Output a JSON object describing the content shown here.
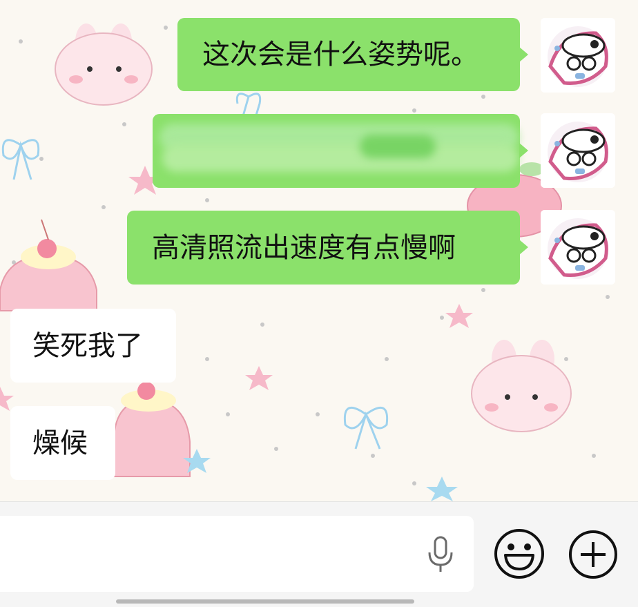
{
  "chat": {
    "messages": [
      {
        "side": "out",
        "text": "这次会是什么姿势呢。"
      },
      {
        "side": "out",
        "text": "",
        "redacted": true
      },
      {
        "side": "out",
        "text": "高清照流出速度有点慢啊"
      },
      {
        "side": "in",
        "text": "笑死我了"
      },
      {
        "side": "in",
        "text": "燥候"
      }
    ]
  },
  "input": {
    "value": ""
  },
  "icons": {
    "voice": "microphone-icon",
    "emoji": "smiley-icon",
    "more": "plus-icon"
  },
  "colors": {
    "outgoing_bubble": "#8be16b",
    "incoming_bubble": "#ffffff",
    "chat_background": "#fbf8f2",
    "input_bar": "#f5f5f5"
  }
}
